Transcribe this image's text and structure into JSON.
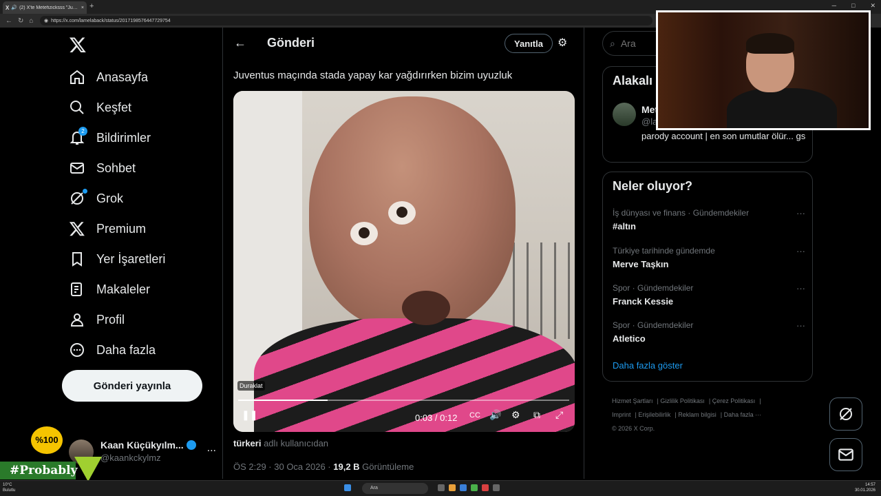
{
  "browser": {
    "tab_title": "(2) X'te Metefizicksss \"Juventu",
    "url": "https://x.com/lamelaback/status/2017198576447729754"
  },
  "sidebar": {
    "items": [
      {
        "label": "Anasayfa",
        "icon": "home-icon"
      },
      {
        "label": "Keşfet",
        "icon": "search-icon"
      },
      {
        "label": "Bildirimler",
        "icon": "bell-icon",
        "badge": "2"
      },
      {
        "label": "Sohbet",
        "icon": "mail-icon"
      },
      {
        "label": "Grok",
        "icon": "grok-icon"
      },
      {
        "label": "Premium",
        "icon": "x-icon"
      },
      {
        "label": "Yer İşaretleri",
        "icon": "bookmark-icon"
      },
      {
        "label": "Makaleler",
        "icon": "article-icon"
      },
      {
        "label": "Profil",
        "icon": "profile-icon"
      },
      {
        "label": "Daha fazla",
        "icon": "more-icon"
      }
    ],
    "post_button": "Gönderi yayınla",
    "account": {
      "name": "Kaan Küçükyılm...",
      "handle": "@kaankckylmz",
      "menu": "..."
    }
  },
  "main": {
    "title": "Gönderi",
    "reply_button": "Yanıtla",
    "tweet_text": "Juventus maçında stada yapay kar yağdırırken bizim uyuzluk",
    "video": {
      "pause_tooltip": "Duraklat",
      "time": "0:03 / 0:12",
      "progress": 0.27
    },
    "attribution_user": "türkeri",
    "attribution_suffix": " adlı kullanıcıdan",
    "meta_time": "ÖS 2:29 · 30 Oca 2026 · ",
    "views_count": "19,2 B",
    "views_label": " Görüntüleme"
  },
  "right": {
    "search_placeholder": "Ara",
    "related": {
      "title": "Alakalı",
      "name": "Met",
      "handle": "@la",
      "bio": "parody account | en son umutlar ölür... gs"
    },
    "whats_happening": {
      "title": "Neler oluyor?",
      "trends": [
        {
          "context": "İş dünyası ve finans · Gündemdekiler",
          "name": "#altın"
        },
        {
          "context": "Türkiye tarihinde gündemde",
          "name": "Merve Taşkın"
        },
        {
          "context": "Spor · Gündemdekiler",
          "name": "Franck Kessie"
        },
        {
          "context": "Spor · Gündemdekiler",
          "name": "Atletico"
        }
      ],
      "more": "Daha fazla göster",
      "trend_menu": "···"
    },
    "footer": [
      "Hizmet Şartları",
      "Gizlilik Politikası",
      "Çerez Politikası",
      "Imprint",
      "Erişilebilirlik",
      "Reklam bilgisi",
      "Daha fazla ···",
      "© 2026 X Corp."
    ]
  },
  "overlay": {
    "brand_badge": "%100",
    "hashtag": "#Probably"
  },
  "taskbar": {
    "weather_temp": "10°C",
    "weather_desc": "Bulutlu",
    "search": "Ara",
    "time": "14:57",
    "date": "30.01.2026"
  },
  "colors": {
    "accent": "#1d9bf0",
    "background": "#000000",
    "text": "#e7e9ea",
    "muted": "#71767b"
  }
}
